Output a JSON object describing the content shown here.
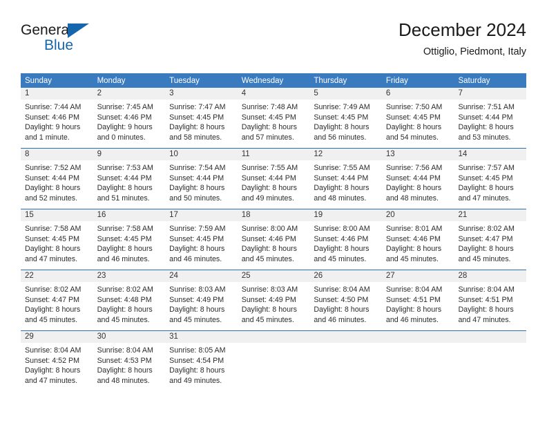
{
  "brand": {
    "name_part1": "General",
    "name_part2": "Blue",
    "triangle_icon": "brand-triangle-icon",
    "blue_hex": "#1566ac"
  },
  "header": {
    "title": "December 2024",
    "subtitle": "Ottiglio, Piedmont, Italy"
  },
  "theme": {
    "header_row_bg": "#3a7bbf",
    "header_row_text": "#ffffff",
    "week_divider": "#2f6fae",
    "daynum_band_bg": "#f0f0f0",
    "body_text": "#2b2b2b"
  },
  "weekdays": [
    "Sunday",
    "Monday",
    "Tuesday",
    "Wednesday",
    "Thursday",
    "Friday",
    "Saturday"
  ],
  "weeks": [
    {
      "days": [
        {
          "num": "1",
          "sunrise": "Sunrise: 7:44 AM",
          "sunset": "Sunset: 4:46 PM",
          "daylight1": "Daylight: 9 hours",
          "daylight2": "and 1 minute."
        },
        {
          "num": "2",
          "sunrise": "Sunrise: 7:45 AM",
          "sunset": "Sunset: 4:46 PM",
          "daylight1": "Daylight: 9 hours",
          "daylight2": "and 0 minutes."
        },
        {
          "num": "3",
          "sunrise": "Sunrise: 7:47 AM",
          "sunset": "Sunset: 4:45 PM",
          "daylight1": "Daylight: 8 hours",
          "daylight2": "and 58 minutes."
        },
        {
          "num": "4",
          "sunrise": "Sunrise: 7:48 AM",
          "sunset": "Sunset: 4:45 PM",
          "daylight1": "Daylight: 8 hours",
          "daylight2": "and 57 minutes."
        },
        {
          "num": "5",
          "sunrise": "Sunrise: 7:49 AM",
          "sunset": "Sunset: 4:45 PM",
          "daylight1": "Daylight: 8 hours",
          "daylight2": "and 56 minutes."
        },
        {
          "num": "6",
          "sunrise": "Sunrise: 7:50 AM",
          "sunset": "Sunset: 4:45 PM",
          "daylight1": "Daylight: 8 hours",
          "daylight2": "and 54 minutes."
        },
        {
          "num": "7",
          "sunrise": "Sunrise: 7:51 AM",
          "sunset": "Sunset: 4:44 PM",
          "daylight1": "Daylight: 8 hours",
          "daylight2": "and 53 minutes."
        }
      ]
    },
    {
      "days": [
        {
          "num": "8",
          "sunrise": "Sunrise: 7:52 AM",
          "sunset": "Sunset: 4:44 PM",
          "daylight1": "Daylight: 8 hours",
          "daylight2": "and 52 minutes."
        },
        {
          "num": "9",
          "sunrise": "Sunrise: 7:53 AM",
          "sunset": "Sunset: 4:44 PM",
          "daylight1": "Daylight: 8 hours",
          "daylight2": "and 51 minutes."
        },
        {
          "num": "10",
          "sunrise": "Sunrise: 7:54 AM",
          "sunset": "Sunset: 4:44 PM",
          "daylight1": "Daylight: 8 hours",
          "daylight2": "and 50 minutes."
        },
        {
          "num": "11",
          "sunrise": "Sunrise: 7:55 AM",
          "sunset": "Sunset: 4:44 PM",
          "daylight1": "Daylight: 8 hours",
          "daylight2": "and 49 minutes."
        },
        {
          "num": "12",
          "sunrise": "Sunrise: 7:55 AM",
          "sunset": "Sunset: 4:44 PM",
          "daylight1": "Daylight: 8 hours",
          "daylight2": "and 48 minutes."
        },
        {
          "num": "13",
          "sunrise": "Sunrise: 7:56 AM",
          "sunset": "Sunset: 4:44 PM",
          "daylight1": "Daylight: 8 hours",
          "daylight2": "and 48 minutes."
        },
        {
          "num": "14",
          "sunrise": "Sunrise: 7:57 AM",
          "sunset": "Sunset: 4:45 PM",
          "daylight1": "Daylight: 8 hours",
          "daylight2": "and 47 minutes."
        }
      ]
    },
    {
      "days": [
        {
          "num": "15",
          "sunrise": "Sunrise: 7:58 AM",
          "sunset": "Sunset: 4:45 PM",
          "daylight1": "Daylight: 8 hours",
          "daylight2": "and 47 minutes."
        },
        {
          "num": "16",
          "sunrise": "Sunrise: 7:58 AM",
          "sunset": "Sunset: 4:45 PM",
          "daylight1": "Daylight: 8 hours",
          "daylight2": "and 46 minutes."
        },
        {
          "num": "17",
          "sunrise": "Sunrise: 7:59 AM",
          "sunset": "Sunset: 4:45 PM",
          "daylight1": "Daylight: 8 hours",
          "daylight2": "and 46 minutes."
        },
        {
          "num": "18",
          "sunrise": "Sunrise: 8:00 AM",
          "sunset": "Sunset: 4:46 PM",
          "daylight1": "Daylight: 8 hours",
          "daylight2": "and 45 minutes."
        },
        {
          "num": "19",
          "sunrise": "Sunrise: 8:00 AM",
          "sunset": "Sunset: 4:46 PM",
          "daylight1": "Daylight: 8 hours",
          "daylight2": "and 45 minutes."
        },
        {
          "num": "20",
          "sunrise": "Sunrise: 8:01 AM",
          "sunset": "Sunset: 4:46 PM",
          "daylight1": "Daylight: 8 hours",
          "daylight2": "and 45 minutes."
        },
        {
          "num": "21",
          "sunrise": "Sunrise: 8:02 AM",
          "sunset": "Sunset: 4:47 PM",
          "daylight1": "Daylight: 8 hours",
          "daylight2": "and 45 minutes."
        }
      ]
    },
    {
      "days": [
        {
          "num": "22",
          "sunrise": "Sunrise: 8:02 AM",
          "sunset": "Sunset: 4:47 PM",
          "daylight1": "Daylight: 8 hours",
          "daylight2": "and 45 minutes."
        },
        {
          "num": "23",
          "sunrise": "Sunrise: 8:02 AM",
          "sunset": "Sunset: 4:48 PM",
          "daylight1": "Daylight: 8 hours",
          "daylight2": "and 45 minutes."
        },
        {
          "num": "24",
          "sunrise": "Sunrise: 8:03 AM",
          "sunset": "Sunset: 4:49 PM",
          "daylight1": "Daylight: 8 hours",
          "daylight2": "and 45 minutes."
        },
        {
          "num": "25",
          "sunrise": "Sunrise: 8:03 AM",
          "sunset": "Sunset: 4:49 PM",
          "daylight1": "Daylight: 8 hours",
          "daylight2": "and 45 minutes."
        },
        {
          "num": "26",
          "sunrise": "Sunrise: 8:04 AM",
          "sunset": "Sunset: 4:50 PM",
          "daylight1": "Daylight: 8 hours",
          "daylight2": "and 46 minutes."
        },
        {
          "num": "27",
          "sunrise": "Sunrise: 8:04 AM",
          "sunset": "Sunset: 4:51 PM",
          "daylight1": "Daylight: 8 hours",
          "daylight2": "and 46 minutes."
        },
        {
          "num": "28",
          "sunrise": "Sunrise: 8:04 AM",
          "sunset": "Sunset: 4:51 PM",
          "daylight1": "Daylight: 8 hours",
          "daylight2": "and 47 minutes."
        }
      ]
    },
    {
      "days": [
        {
          "num": "29",
          "sunrise": "Sunrise: 8:04 AM",
          "sunset": "Sunset: 4:52 PM",
          "daylight1": "Daylight: 8 hours",
          "daylight2": "and 47 minutes."
        },
        {
          "num": "30",
          "sunrise": "Sunrise: 8:04 AM",
          "sunset": "Sunset: 4:53 PM",
          "daylight1": "Daylight: 8 hours",
          "daylight2": "and 48 minutes."
        },
        {
          "num": "31",
          "sunrise": "Sunrise: 8:05 AM",
          "sunset": "Sunset: 4:54 PM",
          "daylight1": "Daylight: 8 hours",
          "daylight2": "and 49 minutes."
        },
        {
          "num": "",
          "sunrise": "",
          "sunset": "",
          "daylight1": "",
          "daylight2": ""
        },
        {
          "num": "",
          "sunrise": "",
          "sunset": "",
          "daylight1": "",
          "daylight2": ""
        },
        {
          "num": "",
          "sunrise": "",
          "sunset": "",
          "daylight1": "",
          "daylight2": ""
        },
        {
          "num": "",
          "sunrise": "",
          "sunset": "",
          "daylight1": "",
          "daylight2": ""
        }
      ]
    }
  ]
}
